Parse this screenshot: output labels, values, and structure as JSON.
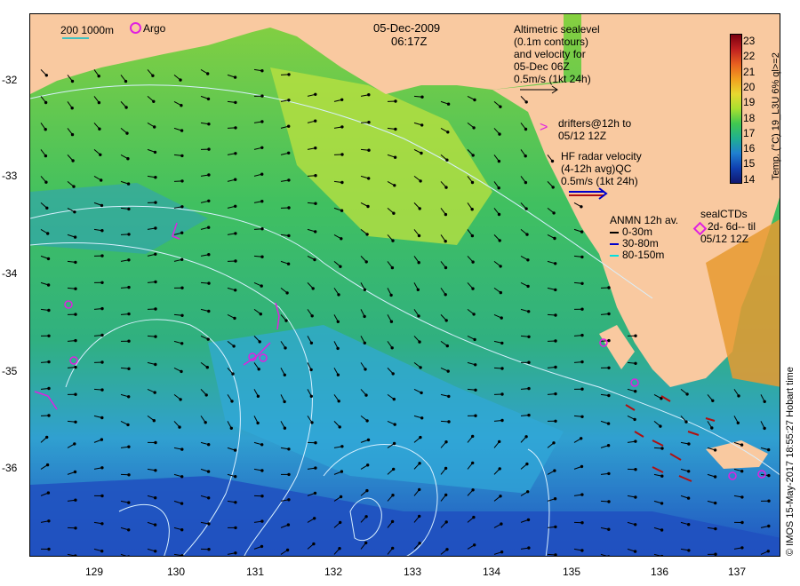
{
  "title": {
    "date": "05-Dec-2009",
    "time": "06:17Z"
  },
  "scale": {
    "label": "200  1000m",
    "argo_label": "Argo"
  },
  "annotations": {
    "altimetric": [
      "Altimetric sealevel",
      "(0.1m contours)",
      "and velocity for",
      "05-Dec 06Z",
      "0.5m/s (1kt 24h)"
    ],
    "drifters": [
      "drifters@12h to",
      "05/12 12Z"
    ],
    "hf_radar": [
      "HF radar velocity",
      "(4-12h avg)QC",
      "0.5m/s (1kt 24h)"
    ],
    "anmn": {
      "title": "ANMN 12h av.",
      "items": [
        {
          "label": "0-30m",
          "color": "#000000"
        },
        {
          "label": "30-80m",
          "color": "#0000cc"
        },
        {
          "label": "80-150m",
          "color": "#00e0e0"
        }
      ]
    },
    "sealctd": [
      "sealCTDs",
      "2d- 6d-- til",
      "05/12 12Z"
    ]
  },
  "colorbar": {
    "title": "Temp. (°C) 19_L3U 6% ql>=2",
    "ticks": [
      "23",
      "22",
      "21",
      "20",
      "19",
      "18",
      "17",
      "16",
      "15",
      "14"
    ],
    "colors": [
      "#7a0010",
      "#c02020",
      "#e86020",
      "#f0a020",
      "#e8d830",
      "#a8e030",
      "#40c850",
      "#20b090",
      "#2080d0",
      "#1040b0",
      "#101870"
    ]
  },
  "credit": "© IMOS 15-May-2017 18:55:27 Hobart time",
  "axes": {
    "y_ticks": [
      "-32",
      "-33",
      "-34",
      "-35",
      "-36"
    ],
    "x_ticks": [
      "129",
      "130",
      "131",
      "132",
      "133",
      "134",
      "135",
      "136",
      "137"
    ]
  },
  "colors": {
    "land": "#f9c9a0",
    "warm_sst": "#a8e040",
    "mid_sst": "#40c060",
    "cool_sst": "#30a0d0",
    "cold_sst": "#2050c0",
    "argo": "#e020e0",
    "contour": "#d8f0ff"
  }
}
